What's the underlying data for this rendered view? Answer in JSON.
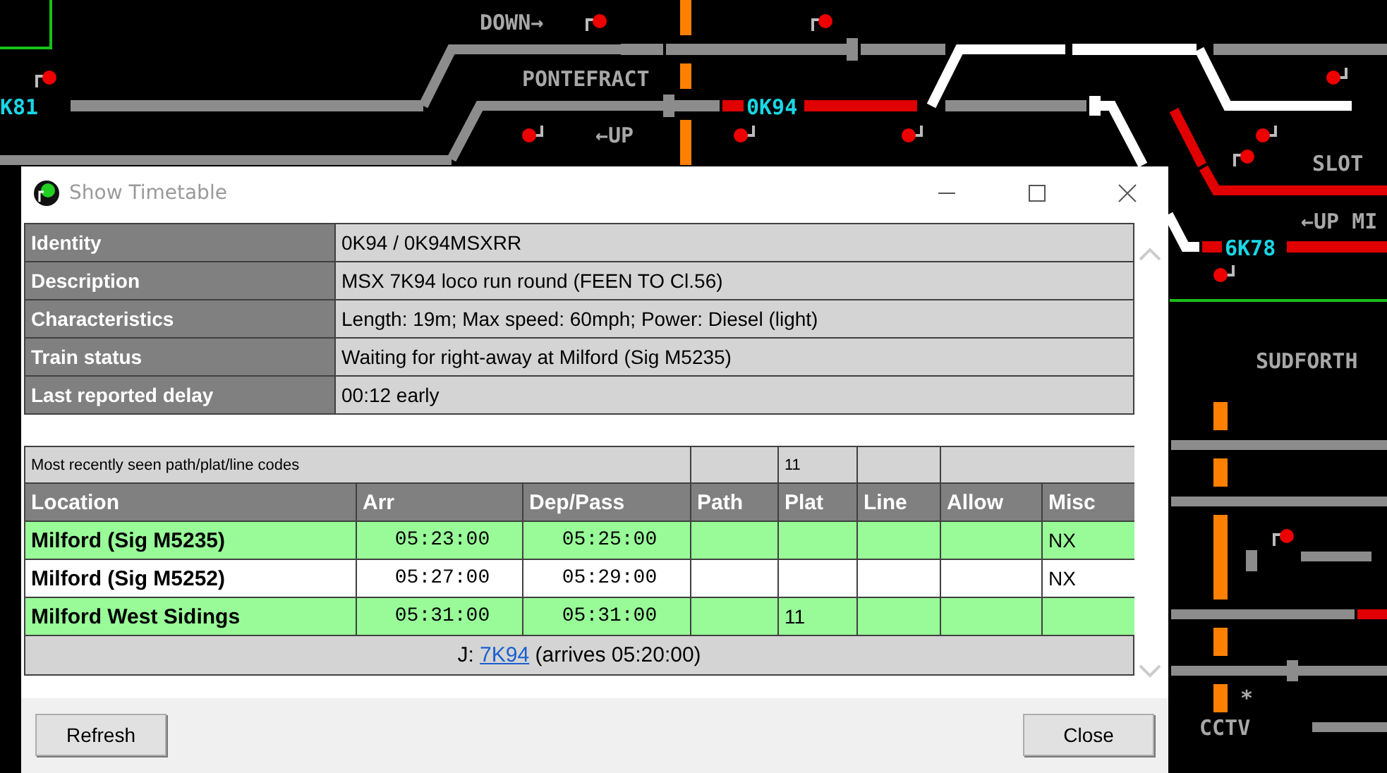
{
  "diagram": {
    "labels": [
      {
        "text": "DOWN→",
        "kind": "place"
      },
      {
        "text": "PONTEFRACT",
        "kind": "place"
      },
      {
        "text": "K81",
        "kind": "train"
      },
      {
        "text": "0K94",
        "kind": "train"
      },
      {
        "text": "←UP",
        "kind": "place"
      },
      {
        "text": "SLOT",
        "kind": "place"
      },
      {
        "text": "←UP MI",
        "kind": "place"
      },
      {
        "text": "6K78",
        "kind": "train"
      },
      {
        "text": "SUDFORTH",
        "kind": "place"
      },
      {
        "text": "*",
        "kind": "place"
      },
      {
        "text": "CCTV",
        "kind": "place"
      }
    ]
  },
  "window": {
    "title": "Show Timetable"
  },
  "info": [
    {
      "label": "Identity",
      "value": "0K94 / 0K94MSXRR"
    },
    {
      "label": "Description",
      "value": "MSX 7K94 loco run round (FEEN TO Cl.56)"
    },
    {
      "label": "Characteristics",
      "value": "Length: 19m; Max speed: 60mph; Power: Diesel (light)"
    },
    {
      "label": "Train status",
      "value": "Waiting for right-away at Milford (Sig M5235)"
    },
    {
      "label": "Last reported delay",
      "value": "00:12 early"
    }
  ],
  "timetable": {
    "codes_row": {
      "label": "Most recently seen path/plat/line codes",
      "plat": "11"
    },
    "columns": [
      "Location",
      "Arr",
      "Dep/Pass",
      "Path",
      "Plat",
      "Line",
      "Allow",
      "Misc"
    ],
    "rows": [
      {
        "location": "Milford (Sig M5235)",
        "arr": "05:23:00",
        "dep": "05:25:00",
        "misc": "NX",
        "shaded": true
      },
      {
        "location": "Milford (Sig M5252)",
        "arr": "05:27:00",
        "dep": "05:29:00",
        "misc": "NX",
        "shaded": false
      },
      {
        "location": "Milford West Sidings",
        "arr": "05:31:00",
        "dep": "05:31:00",
        "plat": "11",
        "shaded": true
      }
    ],
    "join": {
      "prefix": "J:",
      "link": "7K94",
      "suffix": "(arrives 05:20:00)"
    }
  },
  "buttons": [
    {
      "label": "Refresh"
    },
    {
      "label": "Close"
    }
  ]
}
